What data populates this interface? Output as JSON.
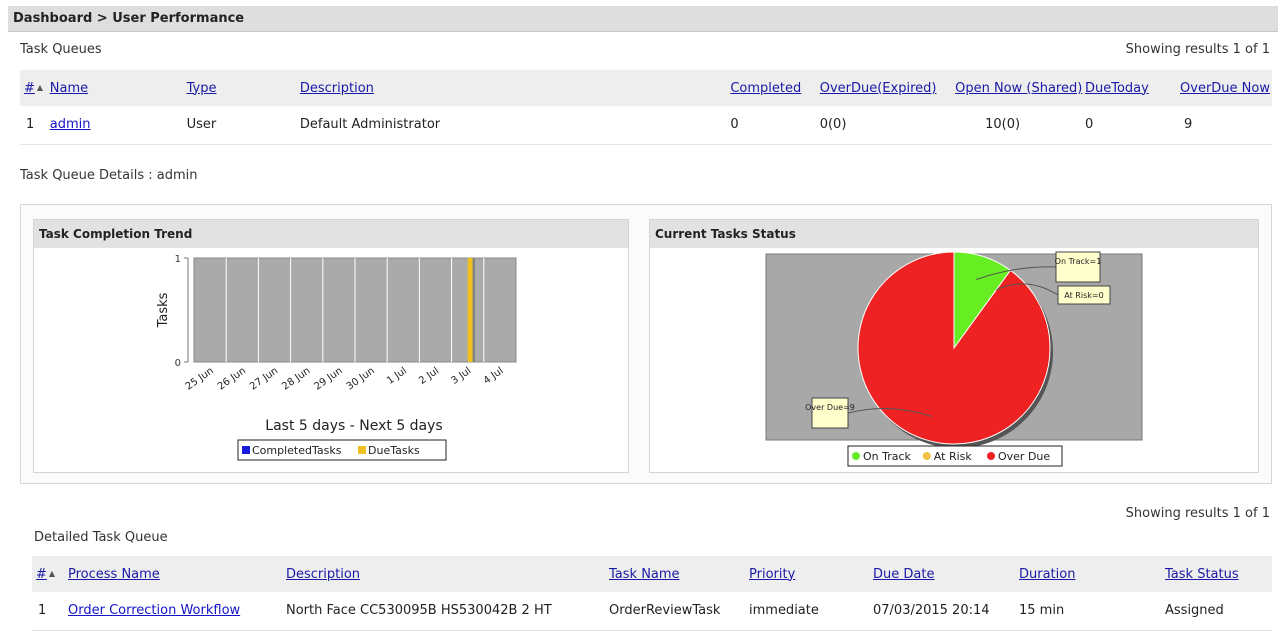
{
  "breadcrumb": "Dashboard > User Performance",
  "task_queues": {
    "title": "Task Queues",
    "results": "Showing results 1 of 1",
    "columns": [
      "#",
      "Name",
      "Type",
      "Description",
      "Completed",
      "OverDue(Expired)",
      "Open Now (Shared)",
      "DueToday",
      "OverDue Now"
    ],
    "rows": [
      {
        "index": "1",
        "name": "admin",
        "type": "User",
        "description": "Default Administrator",
        "completed": "0",
        "overdue_expired": "0(0)",
        "open_now_shared": "10(0)",
        "due_today": "0",
        "overdue_now": "9"
      }
    ]
  },
  "details_label": "Task Queue Details : admin",
  "trend_panel": {
    "title": "Task Completion Trend",
    "chart_data": {
      "type": "bar",
      "ylabel": "Tasks",
      "xlabel": "Last 5 days - Next 5 days",
      "categories": [
        "25 Jun",
        "26 Jun",
        "27 Jun",
        "28 Jun",
        "29 Jun",
        "30 Jun",
        "1 Jul",
        "2 Jul",
        "3 Jul",
        "4 Jul"
      ],
      "yticks": [
        "0",
        "1"
      ],
      "ylim": [
        0,
        1
      ],
      "series": [
        {
          "name": "CompletedTasks",
          "color": "#1a1ae0",
          "values": [
            0,
            0,
            0,
            0,
            0,
            0,
            0,
            0,
            0,
            0
          ]
        },
        {
          "name": "DueTasks",
          "color": "#f0c020",
          "values": [
            0,
            0,
            0,
            0,
            0,
            0,
            0,
            0,
            1,
            0
          ]
        }
      ],
      "grid": true
    }
  },
  "status_panel": {
    "title": "Current Tasks Status",
    "chart_data": {
      "type": "pie",
      "slices": [
        {
          "label": "On Track",
          "value": 1,
          "color": "#66ee22",
          "callout": "On Track=1"
        },
        {
          "label": "At Risk",
          "value": 0,
          "color": "#f0c040",
          "callout": "At Risk=0"
        },
        {
          "label": "Over Due",
          "value": 9,
          "color": "#ee2222",
          "callout": "Over Due=9"
        }
      ],
      "legend": [
        "On Track",
        "At Risk",
        "Over Due"
      ],
      "legend_placement": "bottom"
    }
  },
  "detailed": {
    "title": "Detailed Task Queue",
    "results": "Showing results 1 of 1",
    "columns": [
      "#",
      "Process Name",
      "Description",
      "Task Name",
      "Priority",
      "Due Date",
      "Duration",
      "Task Status"
    ],
    "rows": [
      {
        "index": "1",
        "process_name": "Order Correction Workflow",
        "description": "North Face CC530095B HS530042B 2 HT",
        "task_name": "OrderReviewTask",
        "priority": "immediate",
        "due_date": "07/03/2015 20:14",
        "duration": "15 min",
        "task_status": "Assigned"
      }
    ]
  }
}
